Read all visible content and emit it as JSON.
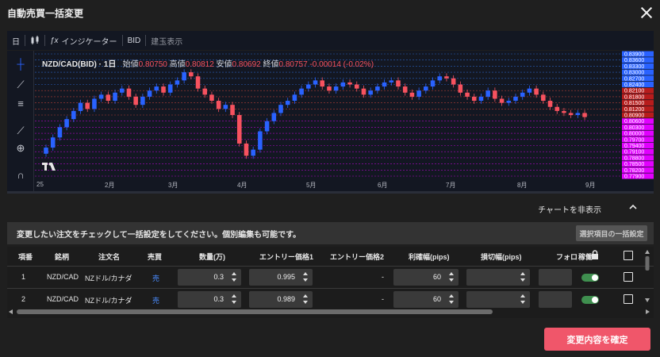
{
  "window": {
    "title": "自動売買一括変更"
  },
  "chart_toolbar": {
    "interval": "日",
    "indicators_label": "インジケーター",
    "price_type": "BID",
    "position_display": "建玉表示"
  },
  "chart_legend": {
    "symbol": "NZD/CAD(BID) · 1日",
    "open_label": "始値",
    "open": "0.80750",
    "high_label": "高値",
    "high": "0.80812",
    "low_label": "安値",
    "low": "0.80692",
    "close_label": "終値",
    "close": "0.80757",
    "change": "-0.00014 (-0.02%)"
  },
  "chart_data": {
    "type": "candlestick",
    "x_ticks": [
      "25",
      "2月",
      "3月",
      "4月",
      "5月",
      "6月",
      "7月",
      "8月",
      "9月"
    ],
    "y_ticks_blue": [
      "0.83900",
      "0.83600",
      "0.83300",
      "0.83000",
      "0.82700",
      "0.82400"
    ],
    "y_ticks_red": [
      "0.82100",
      "0.81800",
      "0.81500",
      "0.81200",
      "0.80900"
    ],
    "y_ticks_magenta": [
      "0.80600",
      "0.80300",
      "0.80000",
      "0.79700",
      "0.79400",
      "0.79100",
      "0.78800",
      "0.78500",
      "0.78200",
      "0.77900"
    ],
    "ylim": [
      0.779,
      0.839
    ],
    "closes": [
      0.793,
      0.798,
      0.803,
      0.807,
      0.811,
      0.815,
      0.812,
      0.817,
      0.819,
      0.816,
      0.82,
      0.822,
      0.818,
      0.814,
      0.818,
      0.821,
      0.823,
      0.82,
      0.824,
      0.826,
      0.83,
      0.828,
      0.822,
      0.819,
      0.816,
      0.812,
      0.814,
      0.809,
      0.795,
      0.789,
      0.792,
      0.801,
      0.806,
      0.81,
      0.814,
      0.816,
      0.819,
      0.822,
      0.824,
      0.826,
      0.823,
      0.821,
      0.823,
      0.825,
      0.824,
      0.822,
      0.819,
      0.821,
      0.823,
      0.825,
      0.826,
      0.823,
      0.82,
      0.818,
      0.821,
      0.823,
      0.826,
      0.828,
      0.827,
      0.824,
      0.82,
      0.818,
      0.816,
      0.818,
      0.821,
      0.817,
      0.815,
      0.816,
      0.818,
      0.82,
      0.822,
      0.819,
      0.816,
      0.813,
      0.811,
      0.81,
      0.809,
      0.81,
      0.808
    ],
    "colors": {
      "up": "#2962ff",
      "down": "#f7525f",
      "up_line": "#3179f5",
      "mid_line": "#e74c3c",
      "low_line": "#e100ff"
    }
  },
  "chart_controls": {
    "hide_chart_label": "チャートを非表示"
  },
  "instruction": {
    "text": "変更したい注文をチェックして一括設定をしてください。個別編集も可能です。",
    "bulk_button": "選択項目の一括設定"
  },
  "table": {
    "headers": [
      "項番",
      "銘柄",
      "注文名",
      "売買",
      "数量(万)",
      "エントリー価格1",
      "エントリー価格2",
      "利確幅(pips)",
      "損切幅(pips)",
      "フォロ",
      "稼働"
    ],
    "rows": [
      {
        "no": "1",
        "symbol": "NZD/CAD",
        "name": "NZドル/カナダ",
        "side": "売",
        "qty": "0.3",
        "entry1": "0.995",
        "entry2": "-",
        "tp": "60",
        "sl": ""
      },
      {
        "no": "2",
        "symbol": "NZD/CAD",
        "name": "NZドル/カナダ",
        "side": "売",
        "qty": "0.3",
        "entry1": "0.989",
        "entry2": "-",
        "tp": "60",
        "sl": ""
      }
    ]
  },
  "footer": {
    "confirm_button": "変更内容を確定"
  }
}
